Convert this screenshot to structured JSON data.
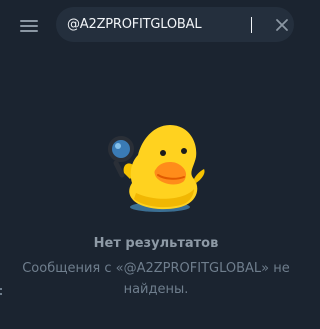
{
  "search": {
    "value": "@A2ZPROFITGLOBAL",
    "menu_icon": "hamburger-menu-icon",
    "clear_icon": "close-icon"
  },
  "empty_state": {
    "sticker": "duck-with-magnifier-sticker",
    "title": "Нет результатов",
    "description": "Сообщения с «@A2ZPROFITGLOBAL» не найдены."
  },
  "colors": {
    "background": "#1b2430",
    "search_field": "#242f3d",
    "title_text": "#8e9aa6",
    "secondary_text": "#6f7e8d"
  }
}
